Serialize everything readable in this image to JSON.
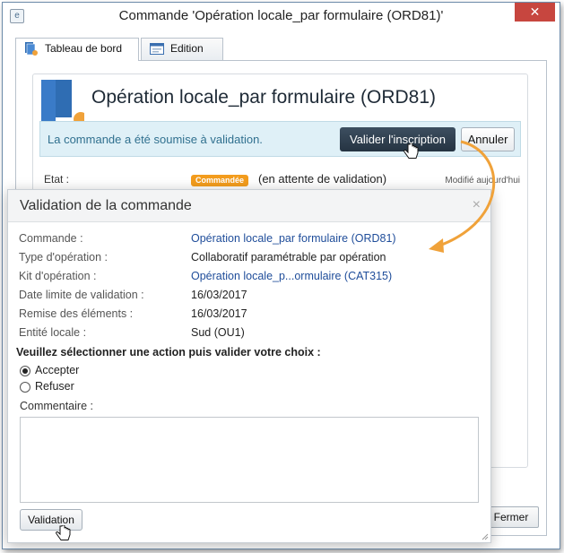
{
  "window": {
    "title": "Commande 'Opération locale_par formulaire (ORD81)'",
    "close_glyph": "✕",
    "app_icon_glyph": "e"
  },
  "tabs": [
    {
      "label": "Tableau de bord",
      "active": true
    },
    {
      "label": "Edition",
      "active": false
    }
  ],
  "dashboard": {
    "title": "Opération locale_par formulaire (ORD81)",
    "info_message": "La commande a été soumise à validation.",
    "validate_button": "Valider l'inscription",
    "cancel_button": "Annuler",
    "state_label": "Etat :",
    "state_badge": "Commandée",
    "state_text": "(en attente de validation)",
    "modified_text": "Modifié aujourd'hui"
  },
  "footer": {
    "close_button": "Fermer"
  },
  "dialog": {
    "title": "Validation de la commande",
    "close_glyph": "×",
    "fields": [
      {
        "label": "Commande :",
        "value": "Opération locale_par formulaire (ORD81)",
        "link": true
      },
      {
        "label": "Type d'opération :",
        "value": "Collaboratif paramétrable par opération",
        "link": false
      },
      {
        "label": "Kit d'opération :",
        "value": "Opération locale_p...ormulaire (CAT315)",
        "link": true
      },
      {
        "label": "Date limite de validation :",
        "value": "16/03/2017",
        "link": false
      },
      {
        "label": "Remise des éléments :",
        "value": "16/03/2017",
        "link": false
      },
      {
        "label": "Entité locale :",
        "value": "Sud (OU1)",
        "link": false
      }
    ],
    "prompt": "Veuillez sélectionner une action puis valider votre choix :",
    "options": [
      {
        "label": "Accepter",
        "selected": true
      },
      {
        "label": "Refuser",
        "selected": false
      }
    ],
    "comment_label": "Commentaire :",
    "comment_value": "",
    "validation_button": "Validation"
  },
  "colors": {
    "accent_arrow": "#f0a23a",
    "badge": "#f39c1d",
    "info_bar": "#dff0f7",
    "link": "#1f4d9a",
    "close_red": "#c7463f"
  }
}
